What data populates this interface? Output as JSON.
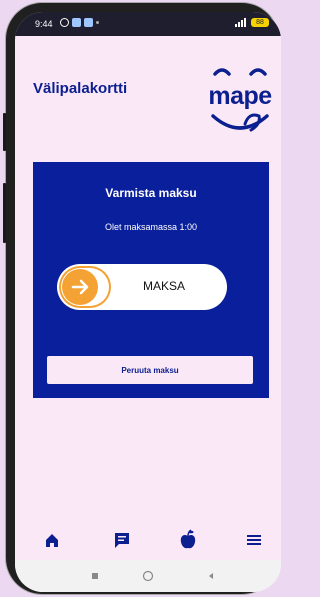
{
  "status_bar": {
    "time": "9:44",
    "battery": "88"
  },
  "header": {
    "app_title": "Välipalakortti",
    "logo_text": "mape"
  },
  "payment_card": {
    "title": "Varmista maksu",
    "subtitle": "Olet maksamassa 1:00",
    "slide_label": "MAKSA",
    "cancel_label": "Peruuta maksu"
  },
  "bottom_nav": {
    "items": [
      {
        "icon": "home-icon"
      },
      {
        "icon": "chat-icon"
      },
      {
        "icon": "apple-icon"
      },
      {
        "icon": "menu-icon"
      }
    ]
  },
  "colors": {
    "primary": "#0a1f9c",
    "background": "#fbe8f7",
    "accent": "#f4a233"
  }
}
